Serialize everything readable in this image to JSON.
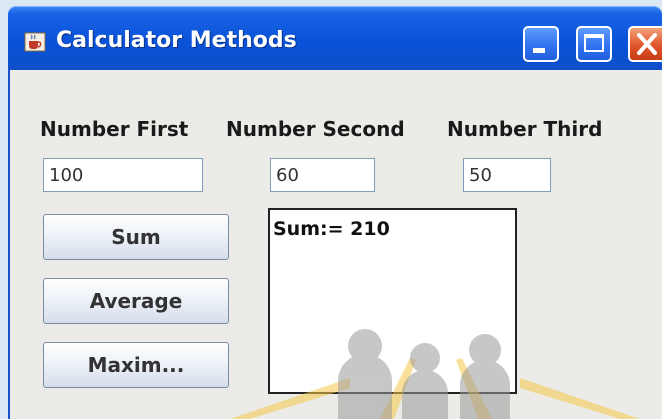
{
  "window": {
    "title": "Calculator Methods",
    "titlebar_color": "#0b52d6",
    "close_color": "#e0542a"
  },
  "labels": {
    "first": "Number First",
    "second": "Number Second",
    "third": "Number Third"
  },
  "fields": {
    "first_value": "100",
    "second_value": "60",
    "third_value": "50"
  },
  "buttons": {
    "sum": "Sum",
    "average": "Average",
    "maximum": "Maxim..."
  },
  "result": {
    "text": "Sum:= 210"
  },
  "icons": {
    "app": "java-coffee-cup-icon",
    "minimize": "minimize-icon",
    "maximize": "maximize-icon",
    "close": "close-icon"
  }
}
